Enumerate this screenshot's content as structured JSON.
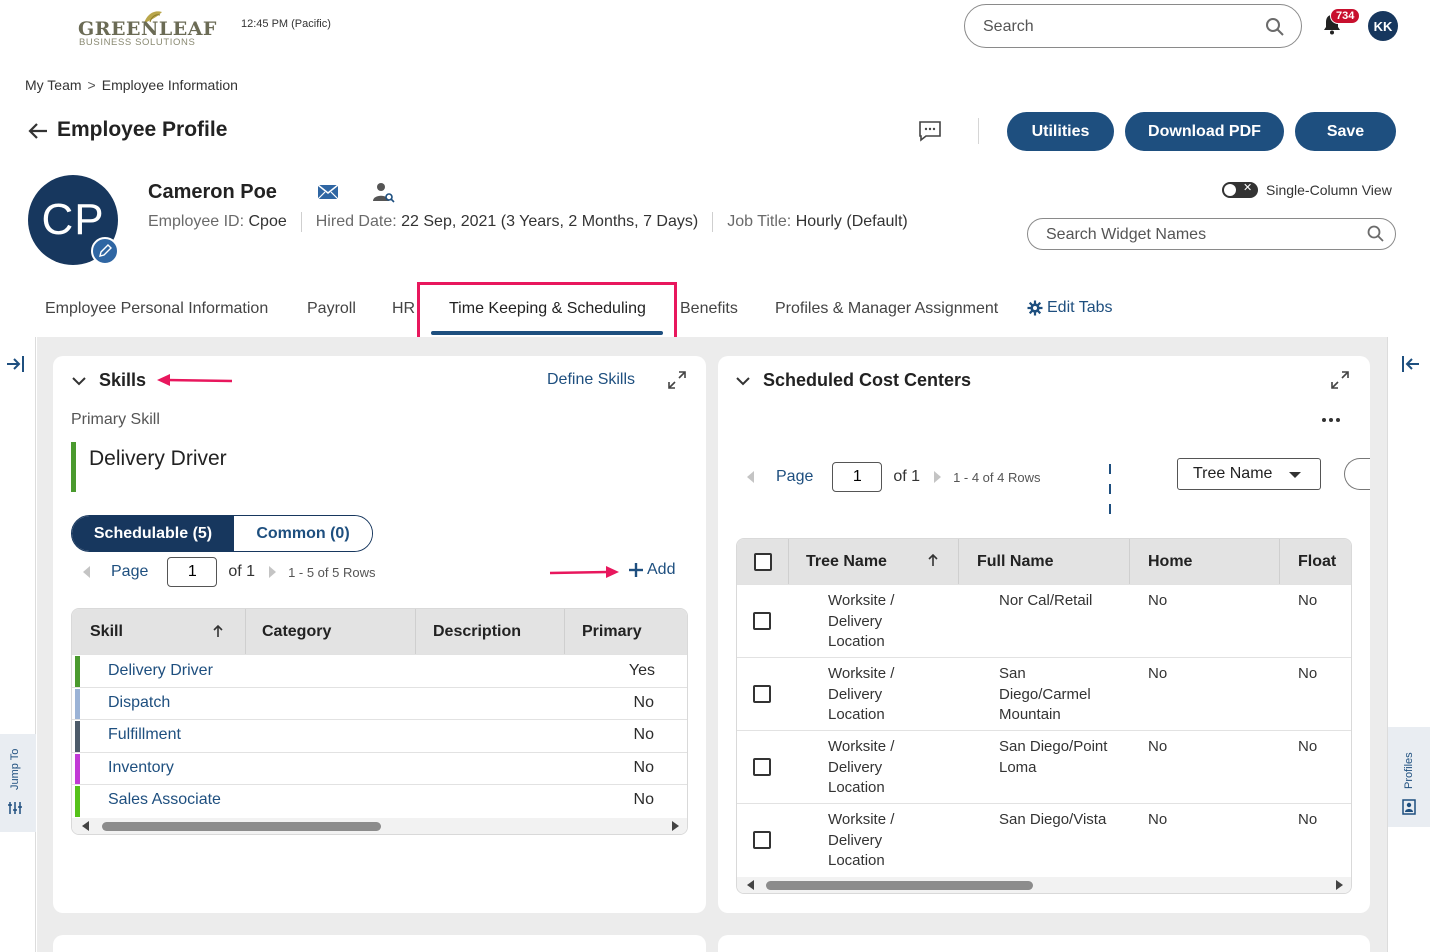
{
  "header": {
    "logo_text": "GREENLEAF",
    "logo_sub": "BUSINESS SOLUTIONS",
    "time": "12:45 PM (Pacific)",
    "search_placeholder": "Search",
    "notification_count": "734",
    "user_initials": "KK"
  },
  "breadcrumb": {
    "items": [
      "My Team",
      "Employee Information"
    ],
    "separator": ">"
  },
  "page": {
    "title": "Employee Profile",
    "buttons": {
      "utilities": "Utilities",
      "download_pdf": "Download PDF",
      "save": "Save"
    }
  },
  "employee": {
    "initials": "CP",
    "name": "Cameron Poe",
    "id_label": "Employee ID:",
    "id_value": "Cpoe",
    "hired_label": "Hired Date:",
    "hired_value": "22 Sep, 2021 (3 Years, 2 Months, 7 Days)",
    "job_label": "Job Title:",
    "job_value": "Hourly (Default)"
  },
  "view": {
    "single_column_label": "Single-Column View",
    "single_column_on": false,
    "widget_search_placeholder": "Search Widget Names"
  },
  "tabs": {
    "items": [
      "Employee Personal Information",
      "Payroll",
      "HR",
      "Time Keeping & Scheduling",
      "Benefits",
      "Profiles & Manager Assignment"
    ],
    "active": "Time Keeping & Scheduling",
    "edit_tabs": "Edit Tabs"
  },
  "sidebars": {
    "left": "Jump To",
    "right": "Profiles"
  },
  "skills": {
    "title": "Skills",
    "define_link": "Define Skills",
    "primary_label": "Primary Skill",
    "primary_value": "Delivery Driver",
    "segments": {
      "schedulable": "Schedulable (5)",
      "common": "Common (0)"
    },
    "pager": {
      "label": "Page",
      "page": "1",
      "of": "of 1",
      "rows": "1 - 5 of 5 Rows"
    },
    "add_label": "Add",
    "columns": [
      "Skill",
      "Category",
      "Description",
      "Primary"
    ],
    "rows": [
      {
        "skill": "Delivery Driver",
        "category": "",
        "description": "",
        "primary": "Yes",
        "color": "#4a9a2e"
      },
      {
        "skill": "Dispatch",
        "category": "",
        "description": "",
        "primary": "No",
        "color": "#9bb3d6"
      },
      {
        "skill": "Fulfillment",
        "category": "",
        "description": "",
        "primary": "No",
        "color": "#4d5b6a"
      },
      {
        "skill": "Inventory",
        "category": "",
        "description": "",
        "primary": "No",
        "color": "#c23ad6"
      },
      {
        "skill": "Sales Associate",
        "category": "",
        "description": "",
        "primary": "No",
        "color": "#55c21a"
      }
    ]
  },
  "cost_centers": {
    "title": "Scheduled Cost Centers",
    "pager": {
      "label": "Page",
      "page": "1",
      "of": "of 1",
      "rows": "1 - 4 of 4 Rows"
    },
    "tree_select": "Tree Name",
    "columns": [
      "Tree Name",
      "Full Name",
      "Home",
      "Float"
    ],
    "rows": [
      {
        "tree": "Worksite / Delivery Location",
        "full": "Nor Cal/Retail",
        "home": "No",
        "float": "No"
      },
      {
        "tree": "Worksite / Delivery Location",
        "full": "San Diego/Carmel Mountain",
        "home": "No",
        "float": "No"
      },
      {
        "tree": "Worksite / Delivery Location",
        "full": "San Diego/Point Loma",
        "home": "No",
        "float": "No"
      },
      {
        "tree": "Worksite / Delivery Location",
        "full": "San Diego/Vista",
        "home": "No",
        "float": "No"
      }
    ]
  },
  "colors": {
    "primary": "#1e4f7f",
    "navy": "#17375e",
    "badge": "#c8102e",
    "annotation": "#e8175d"
  }
}
